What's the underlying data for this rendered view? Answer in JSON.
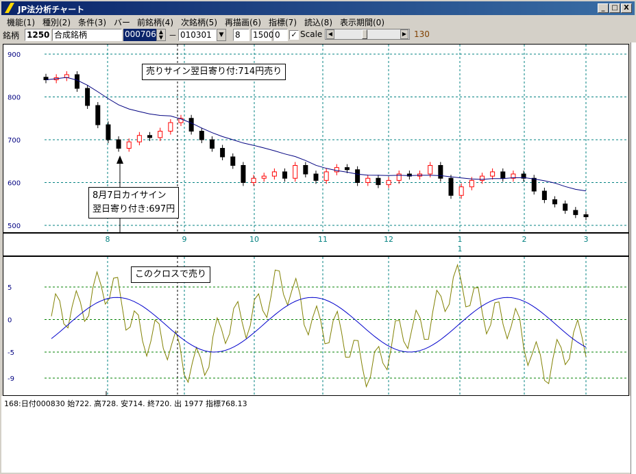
{
  "window": {
    "title": "JP法分析チャート",
    "buttons": {
      "minimize": "_",
      "maximize": "□",
      "close": "X"
    }
  },
  "menu": [
    "機能(1)",
    "種別(2)",
    "条件(3)",
    "バー",
    "前銘柄(4)",
    "次銘柄(5)",
    "再描画(6)",
    "指標(7)",
    "読込(8)",
    "表示期間(0)"
  ],
  "toolbar": {
    "label": "銘柄",
    "code": "1250",
    "name": "合成銘柄",
    "date_spin": "000706",
    "dash": "－",
    "date_select": "010301",
    "param1": "8",
    "param2": "1500",
    "param3": "0",
    "scale_checked": true,
    "scale_label": "Scale",
    "slider_value": "130"
  },
  "price_chart": {
    "y_labels": [
      "900",
      "800",
      "700",
      "600",
      "500"
    ],
    "x_labels": [
      "8",
      "9",
      "10",
      "11",
      "12",
      "1",
      "2",
      "3"
    ],
    "year_marker": "1",
    "annotation_sell": "売りサイン翌日寄り付:714円売り",
    "annotation_buy_line1": "8月7日カイサイン",
    "annotation_buy_line2": "翌日寄り付き:697円"
  },
  "indicator_chart": {
    "y_labels": [
      "5",
      "0",
      "-5",
      "-9"
    ],
    "annotation_cross": "このクロスで売り"
  },
  "status": {
    "text": "168:日付000830 始722. 高728. 安714. 終720. 出 1977 指標768.13"
  },
  "colors": {
    "title_bar": "#0a246a",
    "grid": "#008080",
    "up_candle": "#ff0000",
    "down_candle": "#000000",
    "moving_average": "#000080",
    "oscillator": "#808000",
    "signal": "#0000cc"
  },
  "chart_data": [
    {
      "type": "candlestick",
      "ylim": [
        500,
        900
      ],
      "x_labels": [
        "8",
        "9",
        "10",
        "11",
        "12",
        "1",
        "2",
        "3"
      ],
      "close_approx": [
        840,
        845,
        852,
        820,
        780,
        735,
        700,
        680,
        695,
        710,
        705,
        720,
        740,
        750,
        720,
        700,
        680,
        660,
        640,
        600,
        610,
        615,
        625,
        610,
        640,
        620,
        605,
        625,
        635,
        630,
        600,
        610,
        595,
        605,
        620,
        615,
        620,
        640,
        610,
        570,
        590,
        605,
        615,
        625,
        610,
        620,
        610,
        580,
        560,
        550,
        535,
        525,
        520
      ]
    },
    {
      "type": "line",
      "ylim": [
        -11,
        9
      ],
      "y_ticks": [
        "5",
        "0",
        "-5",
        "-9"
      ]
    }
  ]
}
